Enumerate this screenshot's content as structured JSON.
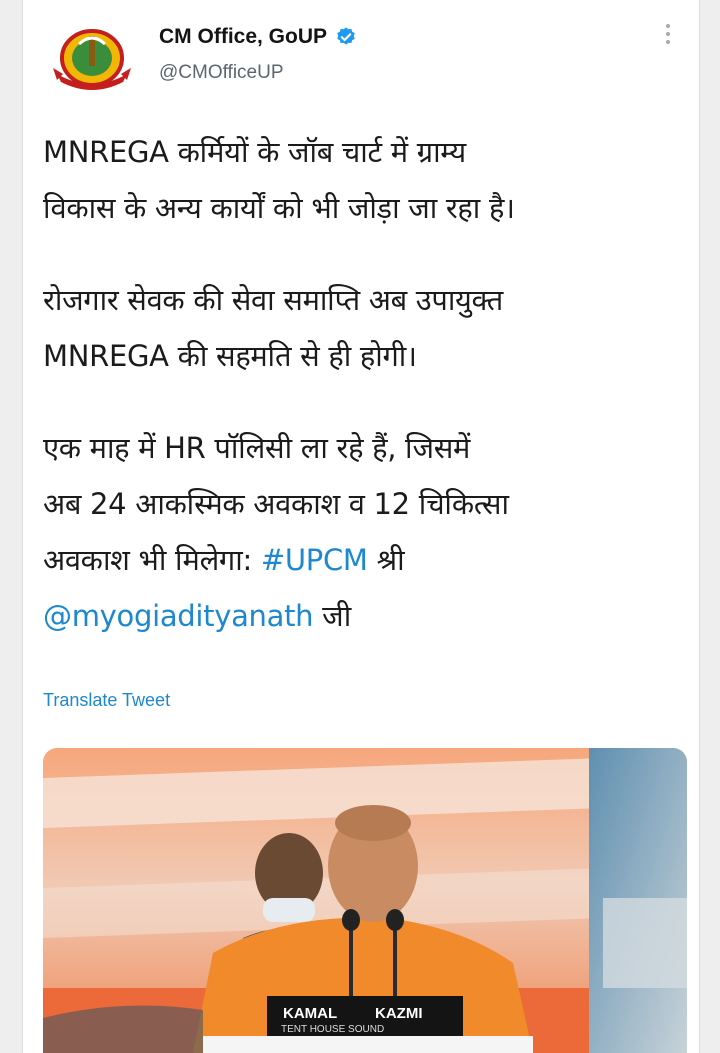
{
  "tweet": {
    "author": {
      "display_name": "CM Office, GoUP",
      "handle": "@CMOfficeUP"
    },
    "paragraph_1": {
      "line_1": "MNREGA कर्मियों के जॉब चार्ट में ग्राम्य",
      "line_2": "विकास के अन्य कार्यों को भी जोड़ा जा रहा है।"
    },
    "paragraph_2": {
      "line_1": "रोजगार सेवक की सेवा समाप्ति अब उपायुक्त",
      "line_2": "MNREGA की सहमति से ही होगी।"
    },
    "paragraph_3": {
      "line_1": "एक माह में HR पॉलिसी ला रहे हैं, जिसमें",
      "line_2": "अब 24 आकस्मिक अवकाश व 12 चिकित्सा",
      "line_3_text": "अवकाश भी मिलेगा: ",
      "hashtag": "#UPCM",
      "line_3_suffix": " श्री",
      "mention": "@myogiadityanath",
      "line_4_suffix": " जी"
    },
    "translate_label": "Translate Tweet",
    "media": {
      "podium_sign_1": "KAMAL",
      "podium_sign_2": "KAZMI",
      "podium_sign_3": "TENT HOUSE  SOUND"
    }
  },
  "colors": {
    "link": "#1d88cf",
    "verified": "#1d9bf0",
    "saffron": "#f08a2a"
  },
  "icons": [
    "government-emblem-icon",
    "verified-badge-icon",
    "more-options-icon"
  ]
}
